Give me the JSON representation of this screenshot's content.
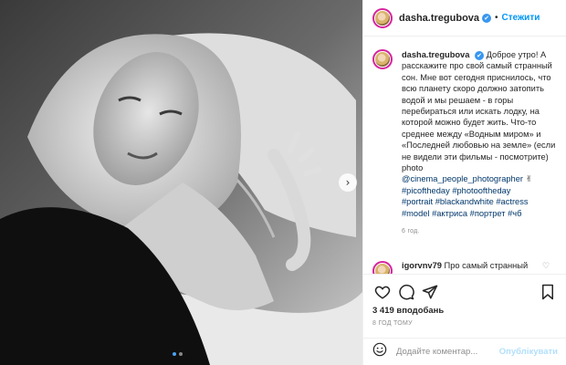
{
  "post": {
    "username": "dasha.tregubova",
    "verified_mark": "✔",
    "separator": "•",
    "follow_label": "Стежити",
    "nav_arrow": "›",
    "caption": {
      "main": "Доброе утро! А расскажите про свой самый странный сон. Мне вот сегодня приснилось, что всю планету скоро должно затопить водой и мы решаем - в горы перебираться или искать лодку, на которой можно будет жить. Что-то среднее между «Водным миром» и «Последней любовью на земле» (если не видели эти фильмы - посмотрите)\nphoto\n",
      "mention": "@cinema_people_photographer",
      "emoji": " ✌",
      "tags": [
        "#picoftheday",
        "#photooftheday",
        "#portrait",
        "#blackandwhite",
        "#actress",
        "#model",
        "#актриса",
        "#портрет",
        "#чб"
      ]
    },
    "caption_time": "6 год.",
    "comment": {
      "username": "igorvnv79",
      "text": "Про самый странный",
      "heart": "♡"
    },
    "likes": "3 419 вподобань",
    "post_time": "8 ГОД ТОМУ",
    "add_comment_placeholder": "Додайте коментар...",
    "publish_label": "Опублікувати"
  },
  "icons": {
    "like": "heart-icon",
    "comment": "comment-icon",
    "share": "share-icon",
    "save": "bookmark-icon",
    "emoji": "emoji-icon"
  },
  "colors": {
    "accent": "#0095f6",
    "link": "#00376b",
    "muted": "#8e8e8e",
    "publish_disabled": "#b2dffc"
  }
}
